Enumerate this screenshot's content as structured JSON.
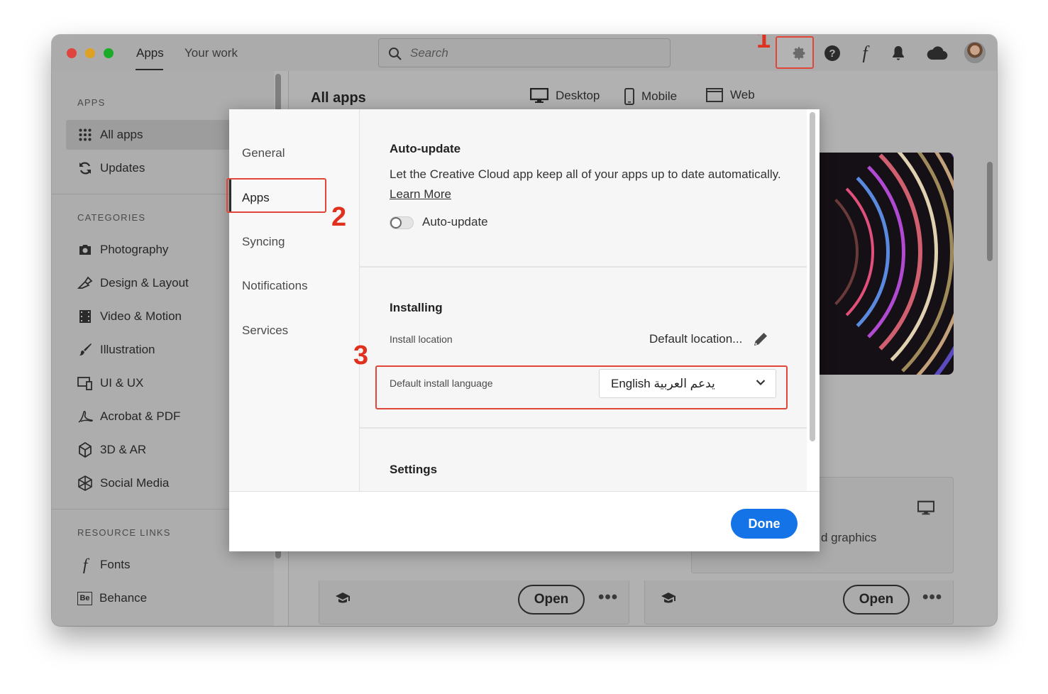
{
  "titlebar": {
    "tabs": [
      {
        "label": "Apps",
        "active": true
      },
      {
        "label": "Your work",
        "active": false
      }
    ],
    "search_placeholder": "Search",
    "icons": [
      "settings-gear-icon",
      "help-icon",
      "fonts-icon",
      "notifications-bell-icon",
      "cloud-icon",
      "avatar"
    ]
  },
  "annotations": {
    "step1": "1",
    "step2": "2",
    "step3": "3",
    "highlight_color": "#e0463a"
  },
  "sidebar": {
    "apps_header": "APPS",
    "apps_items": [
      {
        "label": "All apps",
        "icon": "grid-icon",
        "active": true
      },
      {
        "label": "Updates",
        "icon": "refresh-icon",
        "active": false
      }
    ],
    "categories_header": "CATEGORIES",
    "categories": [
      {
        "label": "Photography",
        "icon": "camera-icon"
      },
      {
        "label": "Design & Layout",
        "icon": "pen-tool-icon"
      },
      {
        "label": "Video & Motion",
        "icon": "film-icon"
      },
      {
        "label": "Illustration",
        "icon": "brush-icon"
      },
      {
        "label": "UI & UX",
        "icon": "devices-icon"
      },
      {
        "label": "Acrobat & PDF",
        "icon": "acrobat-icon"
      },
      {
        "label": "3D & AR",
        "icon": "cube-icon"
      },
      {
        "label": "Social Media",
        "icon": "social-icon"
      }
    ],
    "resources_header": "RESOURCE LINKS",
    "resources": [
      {
        "label": "Fonts",
        "icon": "fonts-icon"
      },
      {
        "label": "Behance",
        "icon": "behance-icon",
        "icon_text": "Be"
      }
    ]
  },
  "main": {
    "title": "All apps",
    "platform_tabs": [
      {
        "label": "Desktop",
        "icon": "desktop-icon"
      },
      {
        "label": "Mobile",
        "icon": "mobile-icon"
      },
      {
        "label": "Web",
        "icon": "web-icon"
      }
    ],
    "card_fragment_text": "d graphics",
    "open_label": "Open",
    "more_label": "•••"
  },
  "dialog": {
    "nav": [
      {
        "label": "General",
        "active": false
      },
      {
        "label": "Apps",
        "active": true
      },
      {
        "label": "Syncing",
        "active": false
      },
      {
        "label": "Notifications",
        "active": false
      },
      {
        "label": "Services",
        "active": false
      }
    ],
    "auto_update": {
      "title": "Auto-update",
      "description": "Let the Creative Cloud app keep all of your apps up to date automatically.",
      "learn_more": "Learn More",
      "toggle_label": "Auto-update",
      "toggle_on": false
    },
    "installing": {
      "title": "Installing",
      "install_location_label": "Install location",
      "install_location_value": "Default location...",
      "default_language_label": "Default install language",
      "default_language_value": "English يدعم العربية"
    },
    "settings": {
      "title": "Settings"
    },
    "done_label": "Done",
    "accent_color": "#1473e6"
  }
}
